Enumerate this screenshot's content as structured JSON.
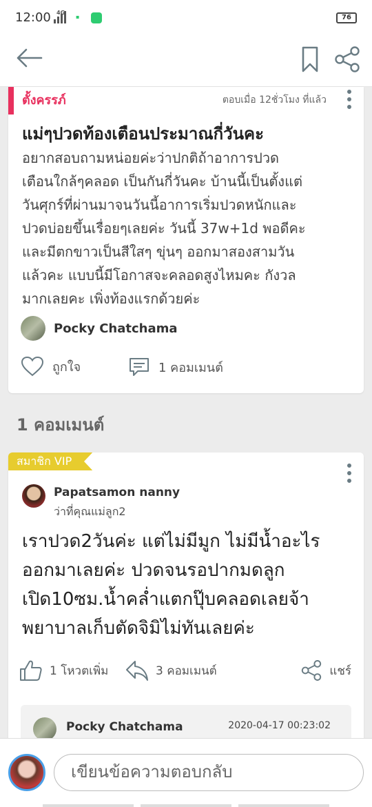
{
  "status_bar": {
    "time": "12:00",
    "network": "4G",
    "battery": "76"
  },
  "app_bar": {
    "back_icon": "arrow-left-icon",
    "bookmark_icon": "bookmark-icon",
    "share_icon": "share-icon"
  },
  "post": {
    "category": "ตั้งครรภ์",
    "time_ago": "ตอบเมื่อ 12ชั่วโมง ที่แล้ว",
    "title": "แม่ๆปวดท้องเตือนประมาณกี่วันคะ",
    "body_lines": [
      "อยากสอบถามหน่อยค่ะว่าปกติถ้าอาการปวด",
      "เตือนใกล้ๆคลอด เป็นกันกี่วันคะ บ้านนี้เป็นตั้งแต่",
      "วันศุกร์ที่ผ่านมาจนวันนี้อาการเริ่มปวดหนักและ",
      "ปวดบ่อยขึ้นเรื่อยๆเลยค่ะ วันนี้ 37w+1d พอดีคะ",
      "และมีตกขาวเป็นสีใสๆ ขุ่นๆ ออกมาสองสามวัน",
      "แล้วคะ แบบนี้มีโอกาสจะคลอดสูงไหมคะ กังวล",
      "มากเลยคะ เพิ่งท้องแรกด้วยค่ะ"
    ],
    "author": "Pocky Chatchama",
    "like_label": "ถูกใจ",
    "comment_label": "1 คอมเมนต์"
  },
  "comments_header": "1 คอมเมนต์",
  "comment": {
    "badge": "สมาชิก VIP",
    "author": "Papatsamon nanny",
    "subtitle": "ว่าที่คุณแม่ลูก2",
    "body_lines": [
      "เราปวด2วันค่ะ แต่ไม่มีมูก ไม่มีน้ำอะไร",
      "ออกมาเลยค่ะ ปวดจนรอปากมดลูก",
      "เปิด10ซม.น้ำคล่ำแตกปุ๊บคลอดเลยจ้า",
      "พยาบาลเก็บตัดจิมิไม่ทันเลยค่ะ"
    ],
    "vote_label": "1 โหวตเพิ่ม",
    "reply_label": "3 คอมเมนต์",
    "share_label": "แชร์",
    "reply_preview": {
      "author": "Pocky Chatchama",
      "date": "2020-04-17 00:23:02"
    }
  },
  "reply_bar": {
    "placeholder": "เขียนข้อความตอบกลับ"
  },
  "colors": {
    "category": "#e8305e",
    "vip": "#e7cc2e",
    "icon": "#6a7c84"
  }
}
